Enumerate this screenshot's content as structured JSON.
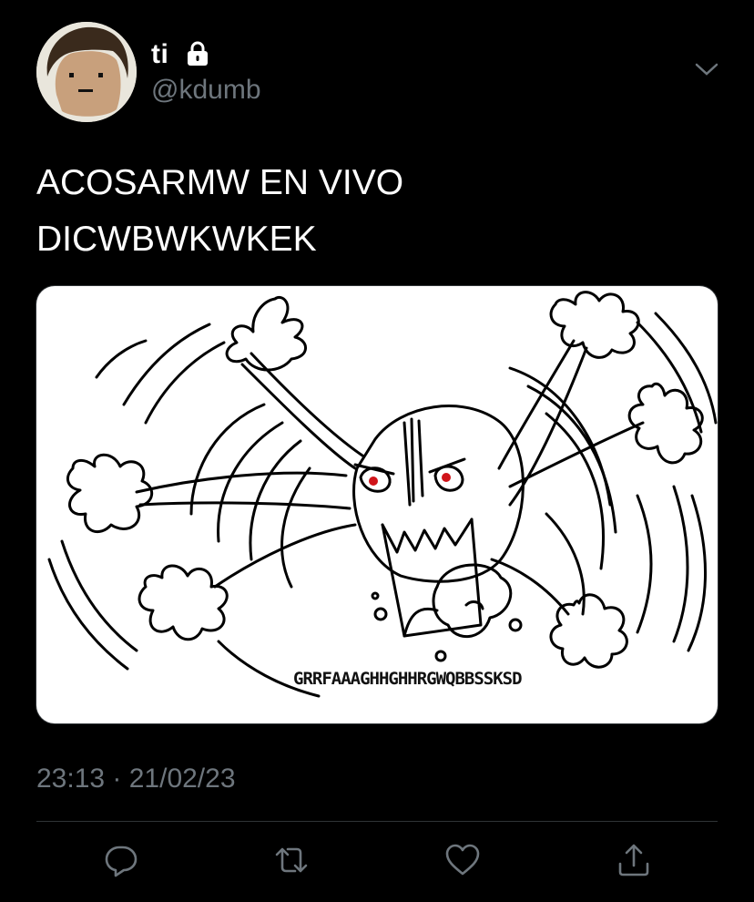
{
  "user": {
    "display_name": "ti",
    "handle": "@kdumb",
    "protected_icon": "lock-icon"
  },
  "tweet": {
    "text_lines": [
      "ACOSARMW EN VIVO",
      "DICWBWKWKEK"
    ],
    "media": {
      "caption_text": "GRRFAAAGHHGHHRGWQBBSSKSD"
    },
    "timestamp": "23:13 · 21/02/23"
  },
  "actions": {
    "reply_icon": "reply-icon",
    "retweet_icon": "retweet-icon",
    "like_icon": "heart-icon",
    "share_icon": "share-icon"
  },
  "colors": {
    "background": "#000000",
    "text": "#ffffff",
    "muted": "#6e767d",
    "eye_red": "#d0141a"
  }
}
